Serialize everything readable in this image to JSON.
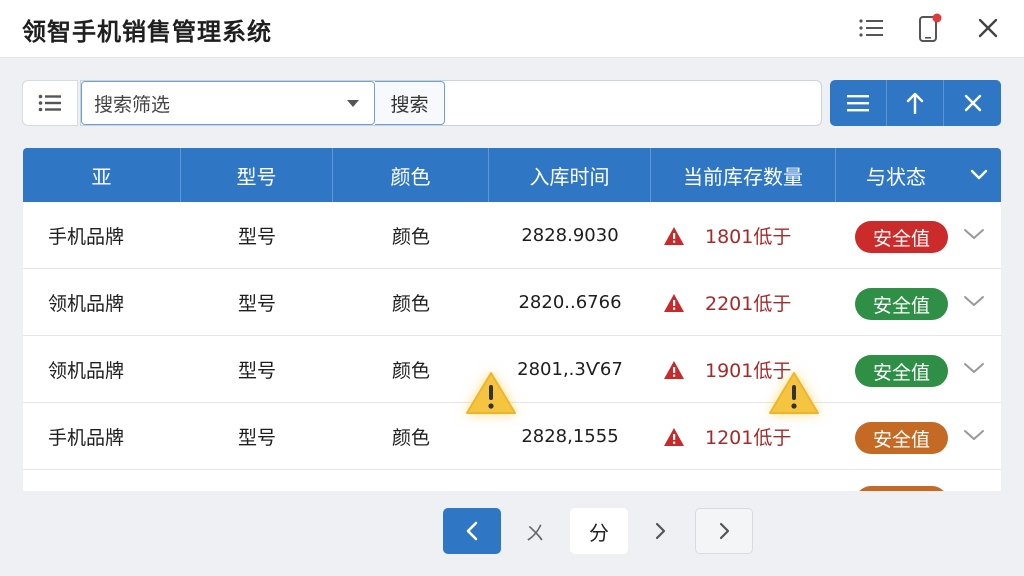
{
  "app": {
    "title": "领智手机销售管理系统"
  },
  "search": {
    "placeholder": "搜索筛选",
    "button_label": "搜索"
  },
  "table": {
    "columns": [
      "亚",
      "型号",
      "颜色",
      "入库时间",
      "当前库存数量",
      "与状态"
    ],
    "rows": [
      {
        "brand": "手机品牌",
        "model": "型号",
        "color": "颜色",
        "time": "2828.9030",
        "stock": "1801低于",
        "status": "安全值",
        "status_color": "#cc2b2b"
      },
      {
        "brand": "领机品牌",
        "model": "型号",
        "color": "颜色",
        "time": "2820..6766",
        "stock": "2201低于",
        "status": "安全值",
        "status_color": "#2f8f46"
      },
      {
        "brand": "领机品牌",
        "model": "型号",
        "color": "颜色",
        "time": "2801,.3Ѵ67",
        "stock": "1901低于",
        "status": "安全值",
        "status_color": "#2f8f46"
      },
      {
        "brand": "手机品牌",
        "model": "型号",
        "color": "颜色",
        "time": "2828,1555",
        "stock": "1201低于",
        "status": "安全值",
        "status_color": "#c56a25"
      }
    ]
  },
  "pagination": {
    "middle_glyph": "ㄨ",
    "current_label": "分"
  },
  "colors": {
    "accent": "#2f77c5",
    "danger": "#cc2b2b",
    "warning_text": "#a52a2a"
  }
}
